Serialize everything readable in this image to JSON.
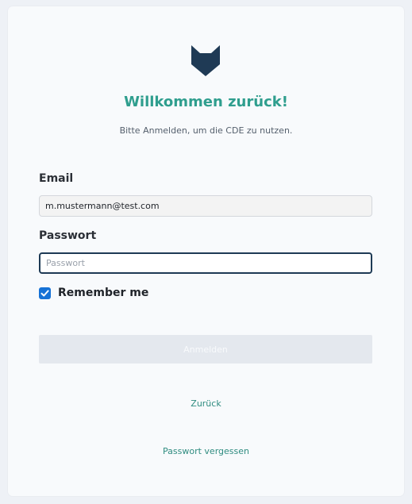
{
  "brand": {
    "logo_icon": "fox-head-icon",
    "logo_color": "#1f3a55"
  },
  "header": {
    "title": "Willkommen zurück!",
    "subtitle": "Bitte Anmelden, um die CDE zu nutzen."
  },
  "form": {
    "email_label": "Email",
    "email_value": "m.mustermann@test.com",
    "password_label": "Passwort",
    "password_placeholder": "Passwort",
    "password_value": "",
    "remember_label": "Remember me",
    "remember_checked": true,
    "submit_label": "Anmelden"
  },
  "links": {
    "back": "Zurück",
    "forgot_password": "Passwort vergessen"
  },
  "colors": {
    "accent": "#2f9e8e",
    "checkbox": "#1672d6",
    "focus_border": "#1e3a55"
  }
}
